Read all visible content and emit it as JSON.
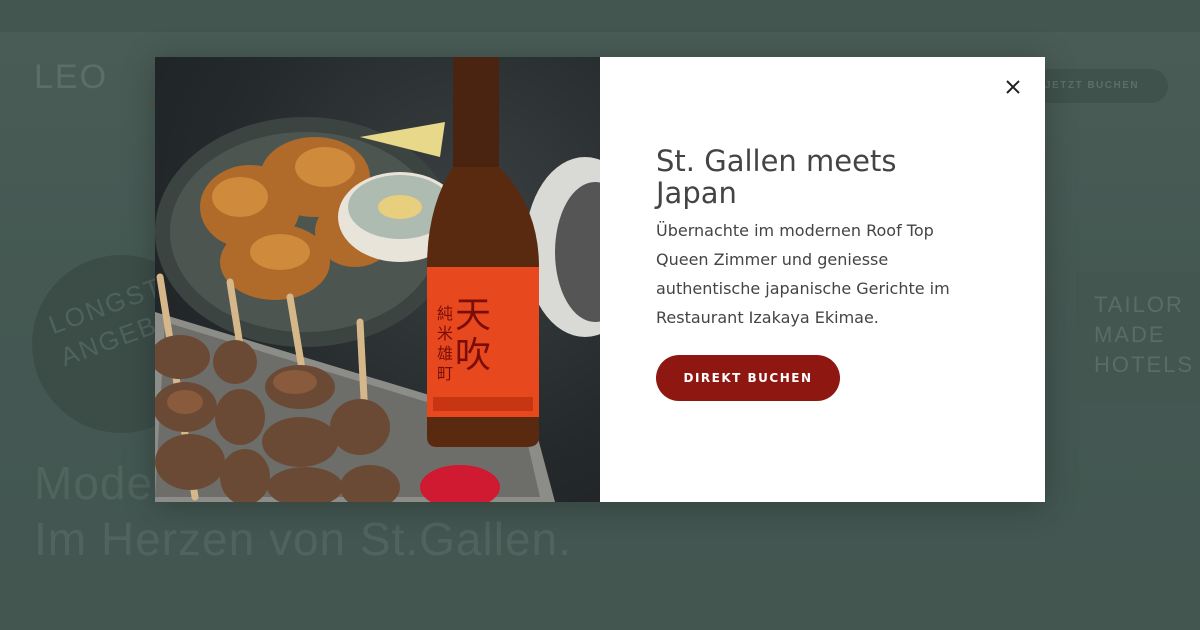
{
  "background_page": {
    "topbar_text": "",
    "logo": "LEO",
    "book_button_label": "JETZT BUCHEN",
    "circle_text": "LONGST\nANGEB",
    "headline": "Mode\nIm Herzen von St.Gallen.",
    "tailor_text": "TAILOR\nMADE\nHOTELS"
  },
  "modal": {
    "image_alt": "Japanese food with yakitori skewers, fried chicken and a sake bottle",
    "close_icon": "close-icon",
    "title": "St. Gallen meets Japan",
    "description": "Übernachte im modernen Roof Top Queen Zimmer und geniesse authentische japanische Gerichte im Restaurant Izakaya Ekimae.",
    "button_label": "DIREKT BUCHEN"
  },
  "colors": {
    "accent": "#8e1712",
    "overlay": "#4b5e59",
    "text": "#444444"
  }
}
